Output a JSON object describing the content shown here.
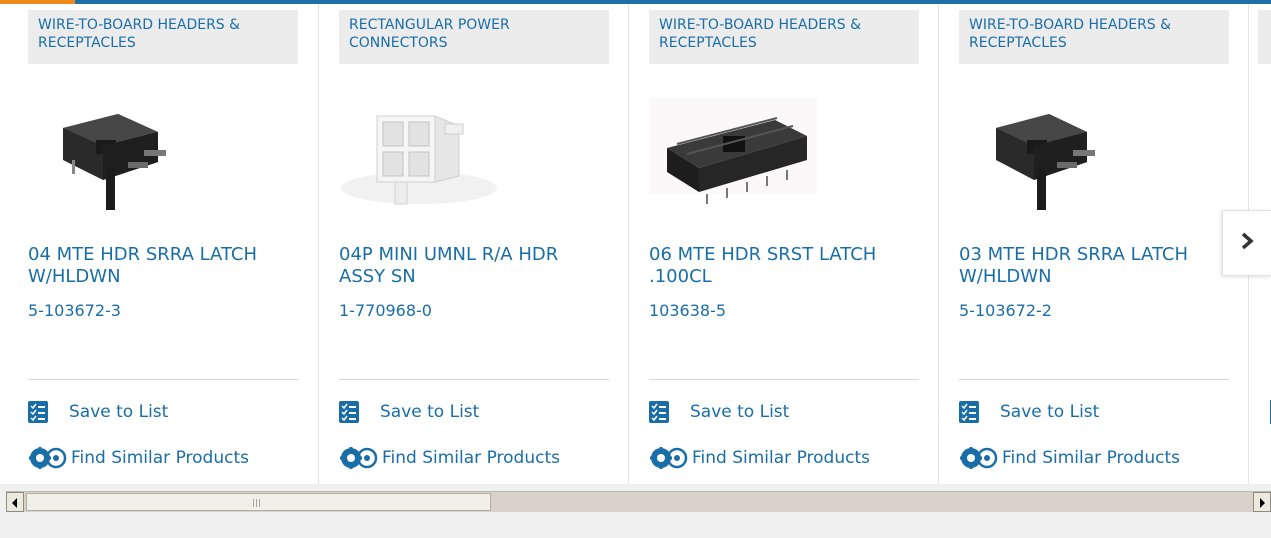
{
  "products": [
    {
      "category": "WIRE-TO-BOARD HEADERS & RECEPTACLES",
      "name": "04 MTE HDR SRRA LATCH W/HLDWN",
      "part_number": "5-103672-3",
      "image": "right-angle-header-black",
      "save_label": "Save to List",
      "similar_label": "Find Similar Products"
    },
    {
      "category": "RECTANGULAR POWER CONNECTORS",
      "name": "04P MINI UMNL R/A HDR ASSY SN",
      "part_number": "1-770968-0",
      "image": "white-power-header",
      "save_label": "Save to List",
      "similar_label": "Find Similar Products"
    },
    {
      "category": "WIRE-TO-BOARD HEADERS & RECEPTACLES",
      "name": "06 MTE HDR SRST LATCH .100CL",
      "part_number": "103638-5",
      "image": "straight-header-black",
      "save_label": "Save to List",
      "similar_label": "Find Similar Products"
    },
    {
      "category": "WIRE-TO-BOARD HEADERS & RECEPTACLES",
      "name": "03 MTE HDR SRRA LATCH W/HLDWN",
      "part_number": "5-103672-2",
      "image": "right-angle-header-black",
      "save_label": "Save to List",
      "similar_label": "Find Similar Products"
    }
  ],
  "carousel": {
    "next_icon": "chevron-right-icon"
  },
  "scrollbar": {
    "left_icon": "arrow-left-icon",
    "right_icon": "arrow-right-icon"
  },
  "colors": {
    "accent": "#f08a1c",
    "topbar": "#1d6fa5",
    "link": "#1a6ea8",
    "category_bg": "#ececec"
  }
}
